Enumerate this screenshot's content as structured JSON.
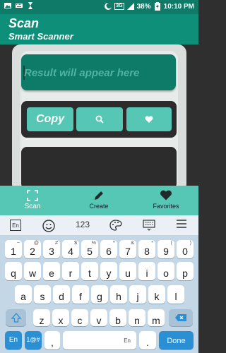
{
  "status_bar": {
    "battery": "38%",
    "time": "10:10 PM",
    "network": "3G"
  },
  "app_bar": {
    "title": "Scan",
    "subtitle": "Smart Scanner"
  },
  "result": {
    "placeholder": "Result will appear here"
  },
  "buttons": {
    "copy_label": "Copy",
    "search_icon": "search-icon",
    "favorite_icon": "heart-icon"
  },
  "bottom_nav": {
    "items": [
      {
        "label": "Scan",
        "icon": "scan-frame-icon"
      },
      {
        "label": "Create",
        "icon": "pencil-icon"
      },
      {
        "label": "Favorites",
        "icon": "heart-icon"
      }
    ]
  },
  "keyboard": {
    "toolbar": {
      "lang": "En",
      "numbers": "123"
    },
    "row1": [
      {
        "k": "1",
        "s": "~"
      },
      {
        "k": "2",
        "s": "@"
      },
      {
        "k": "3",
        "s": "#"
      },
      {
        "k": "4",
        "s": "$"
      },
      {
        "k": "5",
        "s": "%"
      },
      {
        "k": "6",
        "s": "^"
      },
      {
        "k": "7",
        "s": "&"
      },
      {
        "k": "8",
        "s": "*"
      },
      {
        "k": "9",
        "s": "("
      },
      {
        "k": "0",
        "s": ")"
      }
    ],
    "row2": [
      "q",
      "w",
      "e",
      "r",
      "t",
      "y",
      "u",
      "i",
      "o",
      "p"
    ],
    "row3": [
      "a",
      "s",
      "d",
      "f",
      "g",
      "h",
      "j",
      "k",
      "l"
    ],
    "row4": [
      "z",
      "x",
      "c",
      "v",
      "b",
      "n",
      "m"
    ],
    "row5": {
      "lang": "En",
      "sym": "1@#",
      "comma": ",",
      "space": "En",
      "period": ".",
      "done": "Done"
    }
  },
  "colors": {
    "teal_dark": "#0e8f79",
    "teal_light": "#57c7b5",
    "key_blue": "#2b8fd3"
  }
}
